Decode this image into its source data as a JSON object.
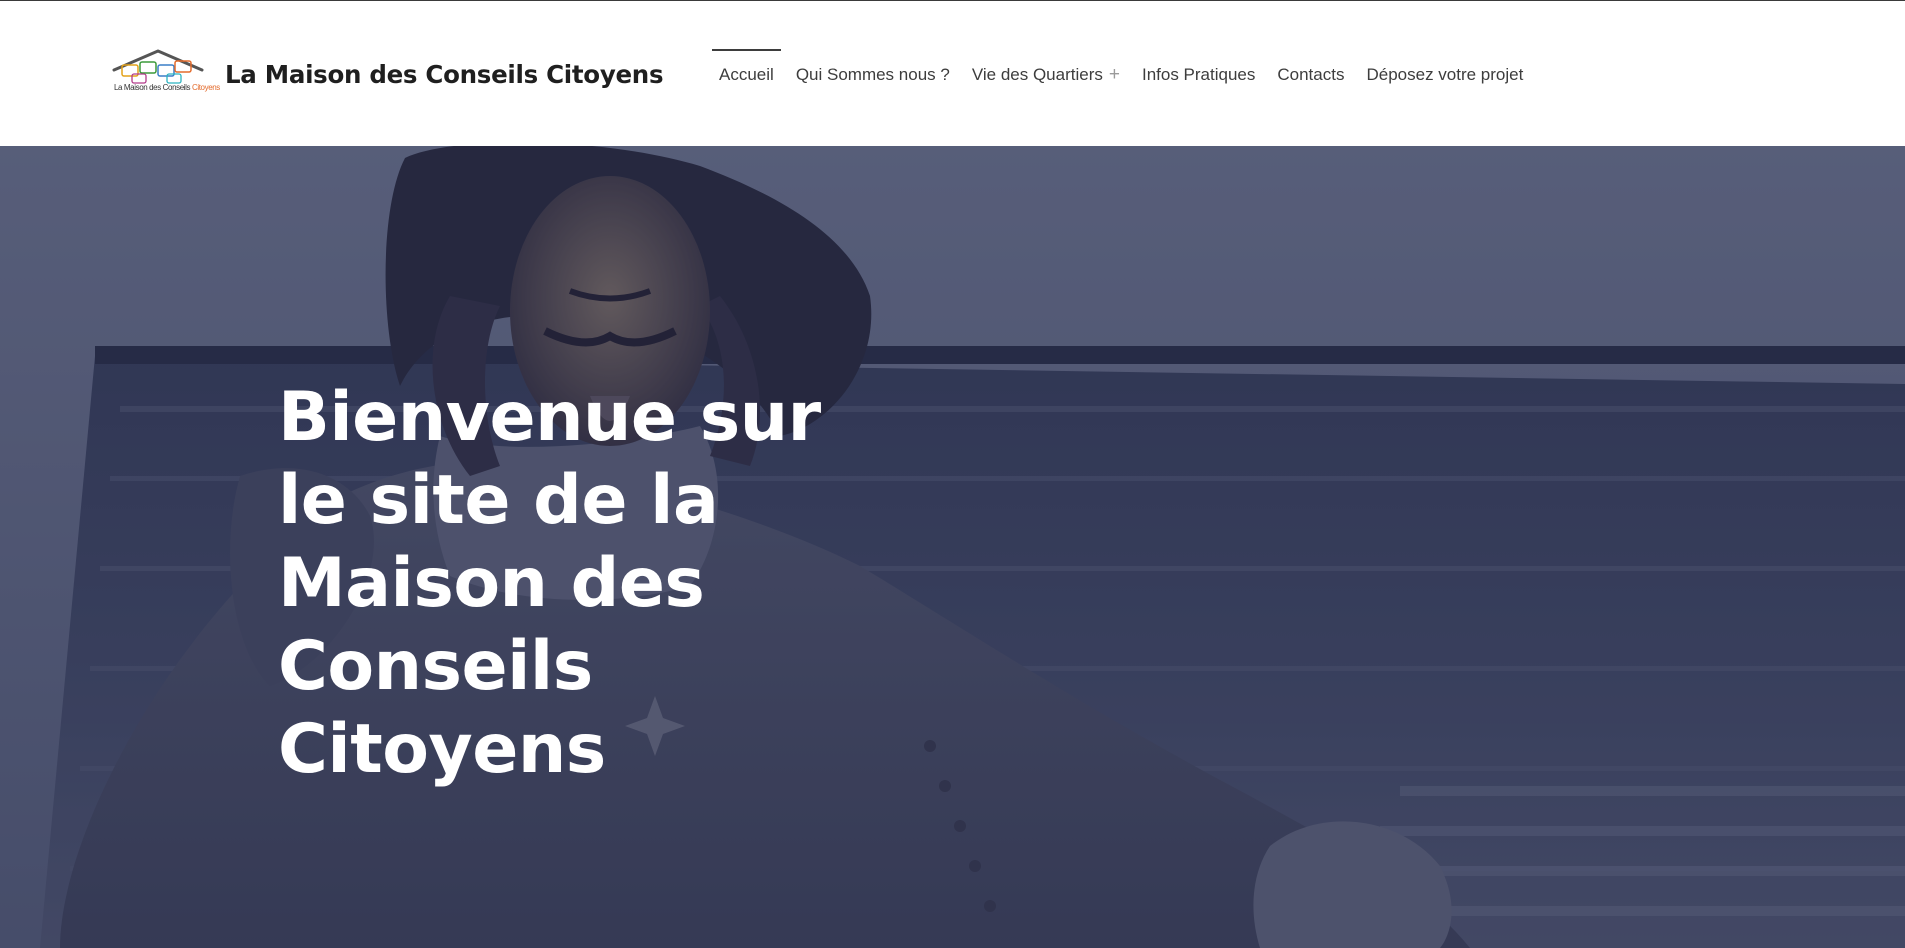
{
  "brand": {
    "logo_caption_prefix": "La Maison des Conseils ",
    "logo_caption_accent": "Citoyens",
    "site_title": "La Maison des Conseils Citoyens"
  },
  "nav": {
    "items": [
      {
        "label": "Accueil",
        "active": true
      },
      {
        "label": "Qui Sommes nous ?"
      },
      {
        "label": "Vie des Quartiers",
        "has_submenu": true,
        "submenu_indicator": "+"
      },
      {
        "label": "Infos Pratiques"
      },
      {
        "label": "Contacts"
      },
      {
        "label": "Déposez votre projet"
      }
    ]
  },
  "hero": {
    "heading": "Bienvenue sur le site de la Maison des Conseils Citoyens",
    "background": "statue-photo"
  },
  "colors": {
    "title_text": "#1f1f1f",
    "nav_text": "#3d3d3d",
    "hero_text": "#ffffff",
    "hero_tint": "#181e44"
  }
}
